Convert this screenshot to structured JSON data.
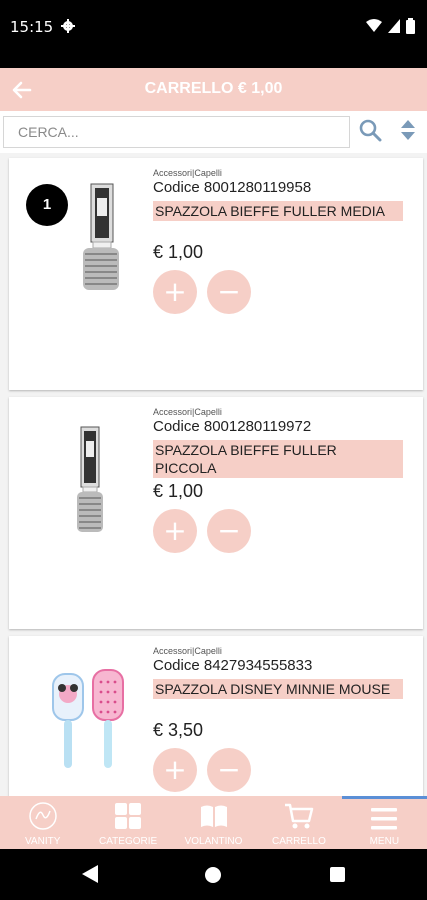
{
  "status_bar": {
    "time": "15:15"
  },
  "header": {
    "title": "CARRELLO € 1,00"
  },
  "search": {
    "placeholder": "CERCA..."
  },
  "colors": {
    "accent": "#f6cfc7",
    "active_tab": "#5b8fd6"
  },
  "products": [
    {
      "category": "Accessori|Capelli",
      "code": "Codice 8001280119958",
      "name": "SPAZZOLA BIEFFE FULLER MEDIA",
      "price": "€ 1,00",
      "quantity": "1"
    },
    {
      "category": "Accessori|Capelli",
      "code": "Codice 8001280119972",
      "name": "SPAZZOLA BIEFFE FULLER PICCOLA",
      "price": "€ 1,00"
    },
    {
      "category": "Accessori|Capelli",
      "code": "Codice 8427934555833",
      "name": "SPAZZOLA DISNEY MINNIE MOUSE",
      "price": "€ 3,50"
    }
  ],
  "buttons": {
    "plus": "+",
    "minus": "−"
  },
  "bottom_nav": [
    {
      "label": "VANITY",
      "icon": "vanity-logo-icon"
    },
    {
      "label": "CATEGORIE",
      "icon": "grid-icon"
    },
    {
      "label": "VOLANTINO",
      "icon": "book-icon"
    },
    {
      "label": "CARRELLO",
      "icon": "cart-icon"
    },
    {
      "label": "MENU",
      "icon": "hamburger-icon"
    }
  ]
}
